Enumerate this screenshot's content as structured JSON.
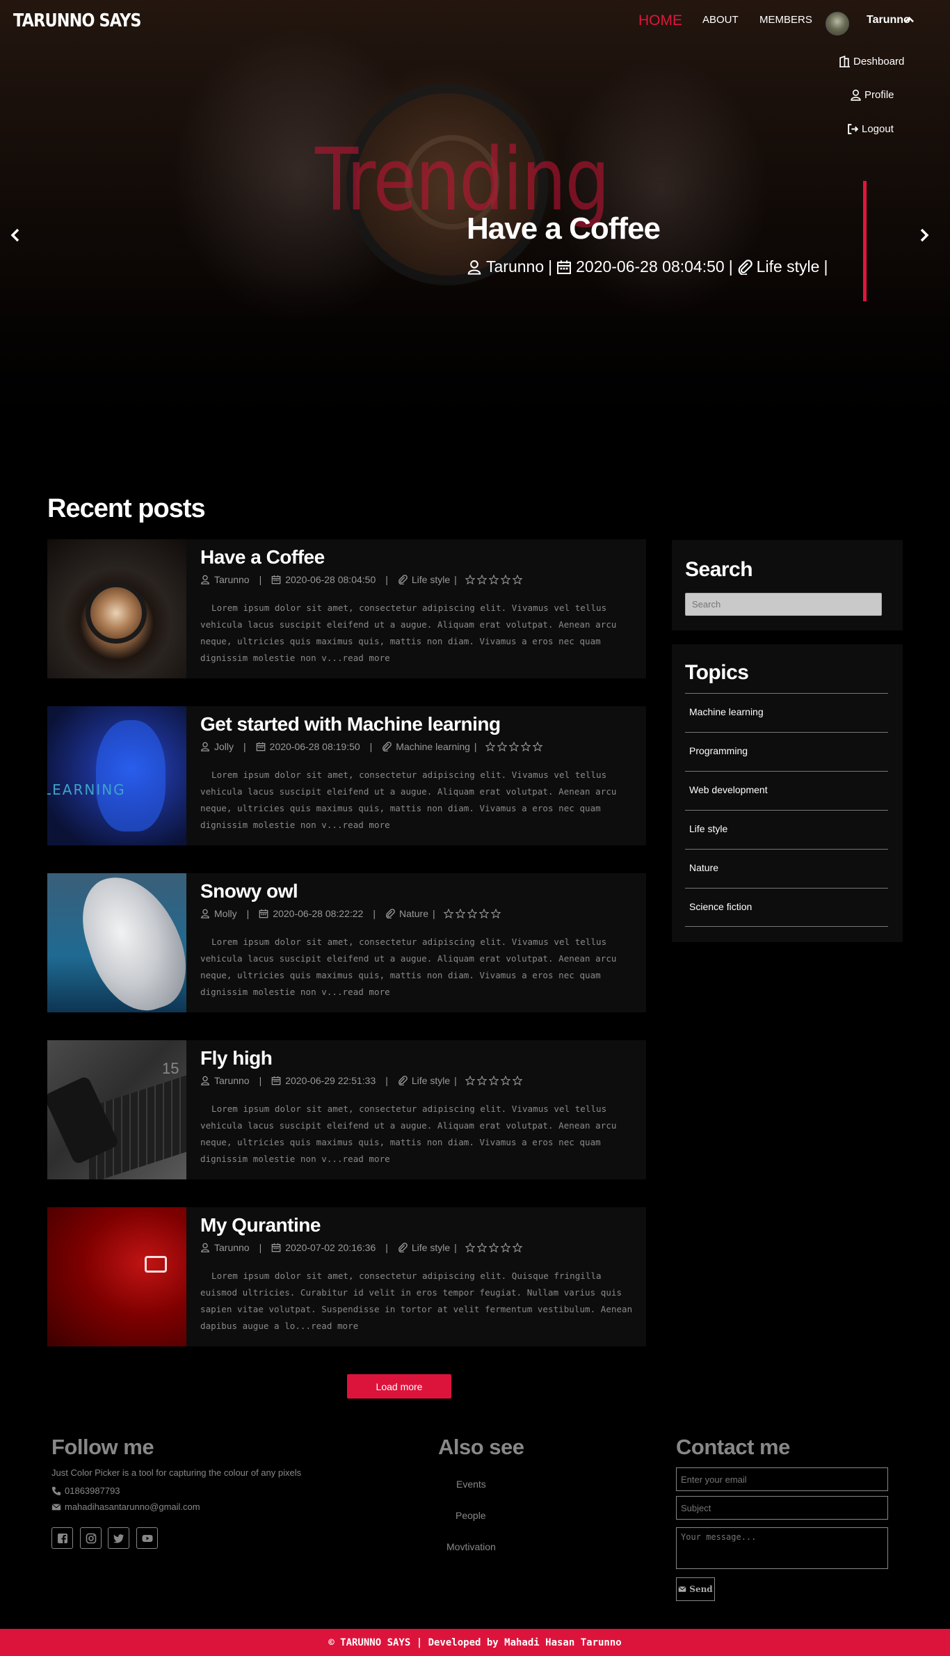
{
  "header": {
    "brand": "TARUNNO SAYS",
    "nav": {
      "home": "HOME",
      "about": "ABOUT",
      "members": "MEMBERS"
    },
    "user": "Tarunno",
    "dropdown": {
      "dashboard": "Deshboard",
      "profile": "Profile",
      "logout": "Logout"
    }
  },
  "hero": {
    "trending": "Trending",
    "title": "Have a Coffee",
    "author": "Tarunno",
    "date": "2020-06-28 08:04:50",
    "category": "Life style",
    "sep1": "|",
    "sep2": "|",
    "sep3": "|"
  },
  "posts_section": {
    "title": "Recent posts"
  },
  "posts": [
    {
      "title": "Have a Coffee",
      "author": "Tarunno",
      "date": "2020-06-28 08:04:50",
      "category": "Life style",
      "rating": 0,
      "excerpt": "Lorem ipsum dolor sit amet, consectetur adipiscing elit. Vivamus vel tellus vehicula lacus suscipit eleifend ut a augue. Aliquam erat volutpat. Aenean arcu neque, ultricies quis maximus quis, mattis non diam. Vivamus a eros nec quam dignissim molestie non v...read more"
    },
    {
      "title": "Get started with Machine learning",
      "author": "Jolly",
      "date": "2020-06-28 08:19:50",
      "category": "Machine learning",
      "rating": 0,
      "excerpt": "Lorem ipsum dolor sit amet, consectetur adipiscing elit. Vivamus vel tellus vehicula lacus suscipit eleifend ut a augue. Aliquam erat volutpat. Aenean arcu neque, ultricies quis maximus quis, mattis non diam. Vivamus a eros nec quam dignissim molestie non v...read more",
      "thumb_label": "LEARNING"
    },
    {
      "title": "Snowy owl",
      "author": "Molly",
      "date": "2020-06-28 08:22:22",
      "category": "Nature",
      "rating": 0,
      "excerpt": "Lorem ipsum dolor sit amet, consectetur adipiscing elit. Vivamus vel tellus vehicula lacus suscipit eleifend ut a augue. Aliquam erat volutpat. Aenean arcu neque, ultricies quis maximus quis, mattis non diam. Vivamus a eros nec quam dignissim molestie non v...read more"
    },
    {
      "title": "Fly high",
      "author": "Tarunno",
      "date": "2020-06-29 22:51:33",
      "category": "Life style",
      "rating": 0,
      "excerpt": "Lorem ipsum dolor sit amet, consectetur adipiscing elit. Vivamus vel tellus vehicula lacus suscipit eleifend ut a augue. Aliquam erat volutpat. Aenean arcu neque, ultricies quis maximus quis, mattis non diam. Vivamus a eros nec quam dignissim molestie non v...read more",
      "thumb_label": "15"
    },
    {
      "title": "My Qurantine",
      "author": "Tarunno",
      "date": "2020-07-02 20:16:36",
      "category": "Life style",
      "rating": 0,
      "excerpt": "Lorem ipsum dolor sit amet, consectetur adipiscing elit. Quisque fringilla euismod ultricies. Curabitur id velit in eros tempor feugiat. Nullam varius quis sapien vitae volutpat. Suspendisse in tortor at velit fermentum vestibulum. Aenean dapibus augue a lo...read more"
    }
  ],
  "meta_sep": "|",
  "sidebar": {
    "search_title": "Search",
    "search_placeholder": "Search",
    "topics_title": "Topics",
    "topics": [
      "Machine learning",
      "Programming",
      "Web development",
      "Life style",
      "Nature",
      "Science fiction"
    ]
  },
  "load_more": "Load more",
  "footer": {
    "follow_title": "Follow me",
    "follow_text": "Just Color Picker is a tool for capturing the colour of any pixels",
    "phone": "01863987793",
    "email": "mahadihasantarunno@gmail.com",
    "also_title": "Also see",
    "also_links": [
      "Events",
      "People",
      "Movtivation"
    ],
    "contact_title": "Contact me",
    "email_placeholder": "Enter your email",
    "subject_placeholder": "Subject",
    "message_placeholder": "Your message...",
    "send_label": "Send",
    "copyright": "© TARUNNO SAYS | Developed by Mahadi Hasan Tarunno"
  },
  "colors": {
    "accent": "#dc143c",
    "background": "#000000",
    "card": "#0d0d0d"
  },
  "icons": [
    "user-icon",
    "calendar-icon",
    "paperclip-icon",
    "star-icon",
    "dashboard-icon",
    "profile-icon",
    "logout-icon",
    "phone-icon",
    "envelope-icon",
    "facebook-icon",
    "instagram-icon",
    "twitter-icon",
    "youtube-icon",
    "chevron-up-icon",
    "chevron-left-icon",
    "chevron-right-icon"
  ]
}
